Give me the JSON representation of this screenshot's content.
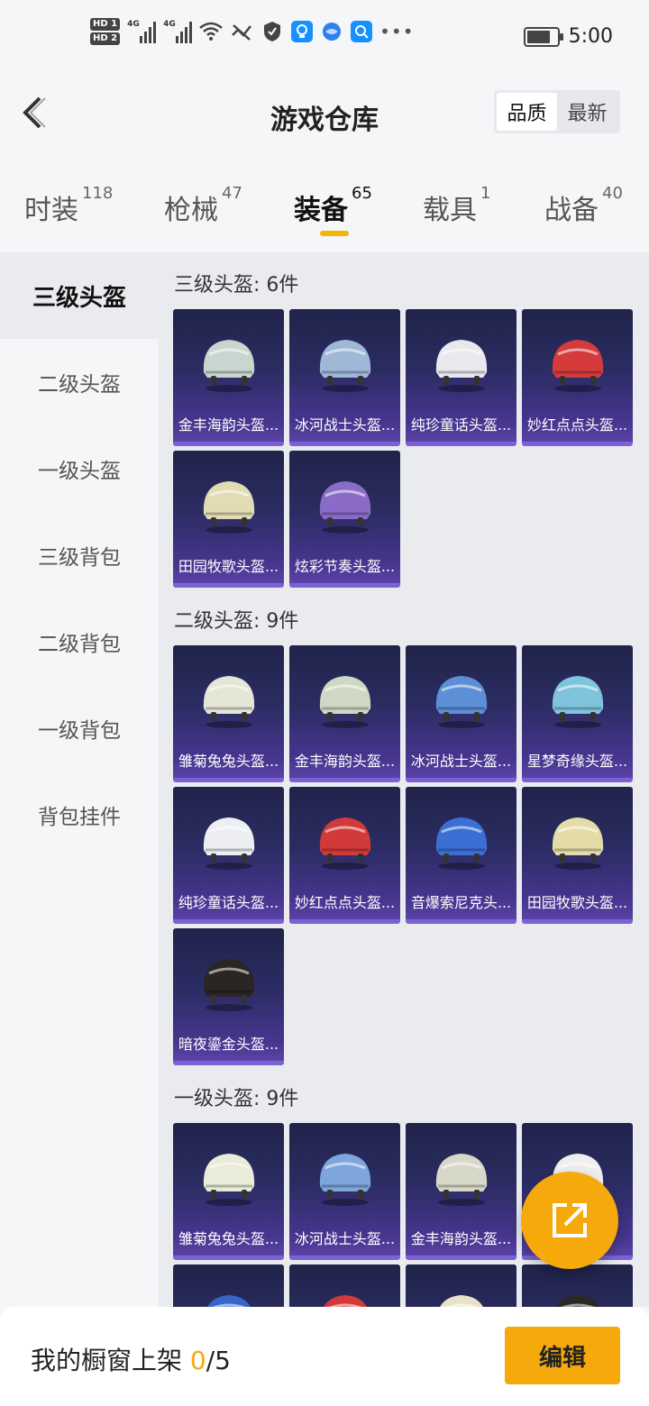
{
  "status_bar": {
    "hd1": "HD 1",
    "hd2": "HD 2",
    "net1": "4G",
    "net2": "4G",
    "time": "5:00",
    "battery_level": 0.78,
    "icons": [
      "wifi-icon",
      "mute-icon",
      "shield-icon",
      "bulb-app-icon",
      "browser-app-icon",
      "search-app-icon",
      "more-dots-icon"
    ]
  },
  "header": {
    "title": "游戏仓库",
    "sort_options": [
      "品质",
      "最新"
    ],
    "selected_sort": "品质"
  },
  "tabs": [
    {
      "label": "时装",
      "count": "118"
    },
    {
      "label": "枪械",
      "count": "47"
    },
    {
      "label": "装备",
      "count": "65",
      "active": true
    },
    {
      "label": "载具",
      "count": "1"
    },
    {
      "label": "战备",
      "count": "40"
    }
  ],
  "sidebar": {
    "items": [
      "三级头盔",
      "二级头盔",
      "一级头盔",
      "三级背包",
      "二级背包",
      "一级背包",
      "背包挂件"
    ],
    "active": "三级头盔"
  },
  "sections": [
    {
      "title": "三级头盔: 6件",
      "items": [
        {
          "name": "金丰海韵头盔...",
          "color": "#c9d6cf"
        },
        {
          "name": "冰河战士头盔...",
          "color": "#9fb8d8"
        },
        {
          "name": "纯珍童话头盔...",
          "color": "#e8e8ee"
        },
        {
          "name": "妙红点点头盔...",
          "color": "#d63b3b"
        },
        {
          "name": "田园牧歌头盔...",
          "color": "#e2dcb4"
        },
        {
          "name": "炫彩节奏头盔...",
          "color": "#8a6cc8"
        }
      ]
    },
    {
      "title": "二级头盔: 9件",
      "items": [
        {
          "name": "雏菊兔兔头盔...",
          "color": "#e4e6d6"
        },
        {
          "name": "金丰海韵头盔...",
          "color": "#cfd8c4"
        },
        {
          "name": "冰河战士头盔...",
          "color": "#5d8fd6"
        },
        {
          "name": "星梦奇缘头盔...",
          "color": "#7fc4dc"
        },
        {
          "name": "纯珍童话头盔...",
          "color": "#eceef2"
        },
        {
          "name": "妙红点点头盔...",
          "color": "#d23a3a"
        },
        {
          "name": "音爆索尼克头...",
          "color": "#3b6fd4"
        },
        {
          "name": "田园牧歌头盔...",
          "color": "#e4dca8"
        },
        {
          "name": "暗夜鎏金头盔...",
          "color": "#2a2624"
        }
      ]
    },
    {
      "title": "一级头盔: 9件",
      "items": [
        {
          "name": "雏菊兔兔头盔...",
          "color": "#e8ecd8"
        },
        {
          "name": "冰河战士头盔...",
          "color": "#7fa6dc"
        },
        {
          "name": "金丰海韵头盔...",
          "color": "#d8d8c8"
        },
        {
          "name": "",
          "color": "#eeeeee"
        },
        {
          "name": "",
          "color": "#3766c8"
        },
        {
          "name": "",
          "color": "#d23a3a"
        },
        {
          "name": "",
          "color": "#e8e2c8"
        },
        {
          "name": "",
          "color": "#2b2826"
        }
      ]
    }
  ],
  "bottom": {
    "label": "我的橱窗上架 ",
    "current": "0",
    "total": "/5",
    "edit_label": "编辑"
  }
}
